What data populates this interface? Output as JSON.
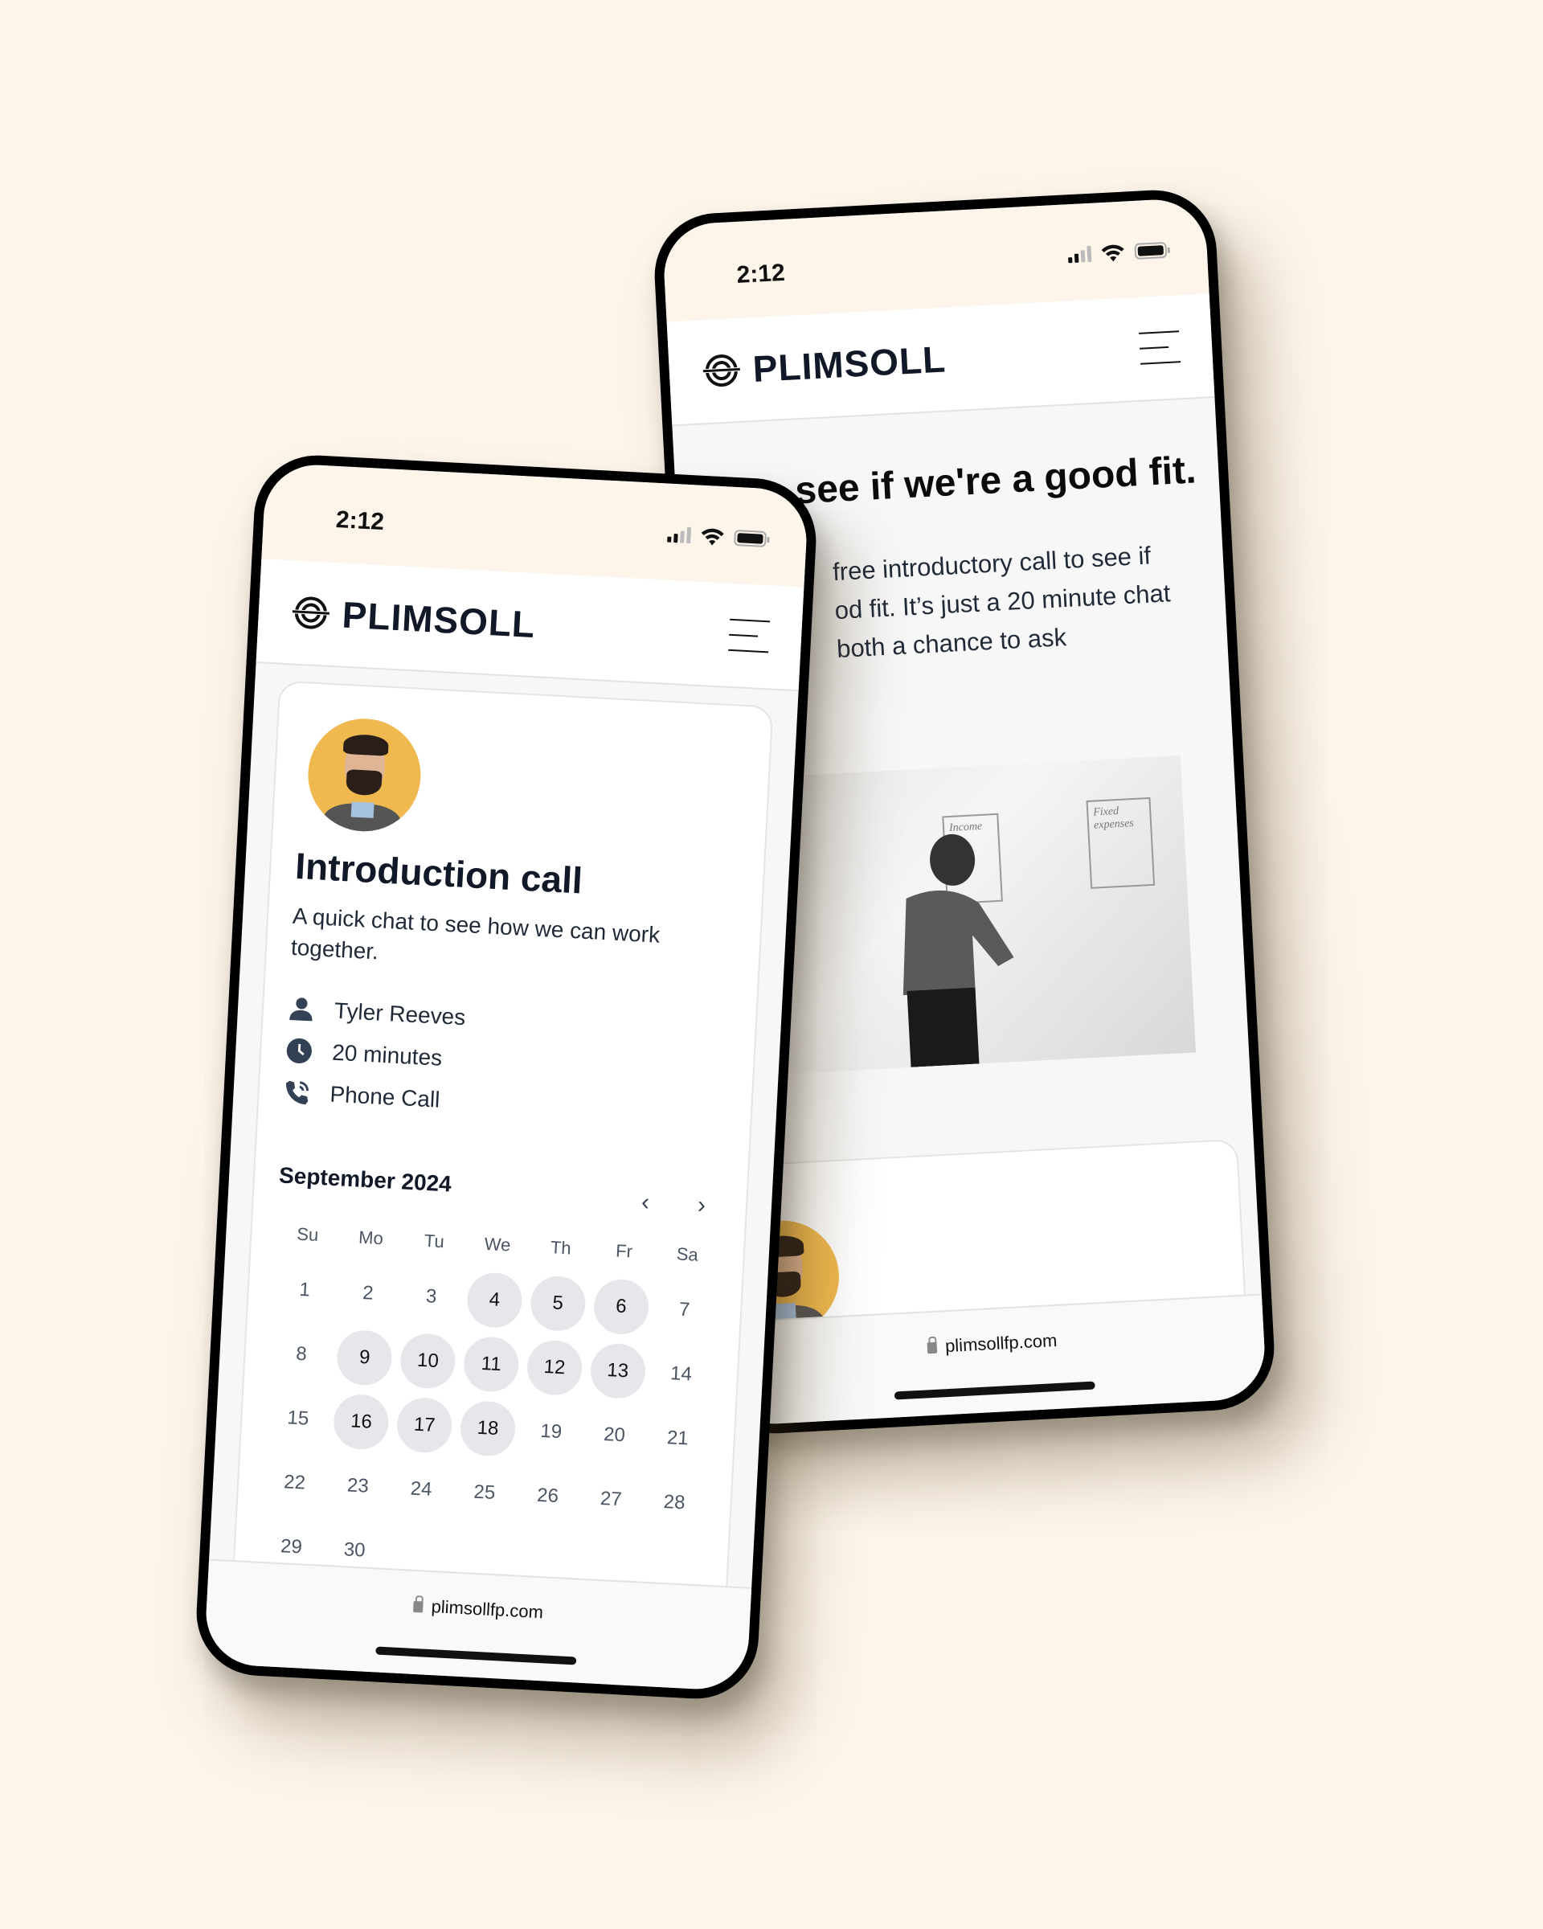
{
  "colors": {
    "background": "#fdf5ea",
    "avatar_bg": "#f0b94f",
    "available_day_bg": "#e5e7eb",
    "text_dark": "#111827"
  },
  "status_bar": {
    "time": "2:12"
  },
  "brand": {
    "name": "PLIMSOLL",
    "logo_icon": "plimsoll-line-icon",
    "menu_icon": "hamburger-menu-icon"
  },
  "browser": {
    "url": "plimsollfp.com",
    "lock_icon": "lock-icon"
  },
  "back_phone": {
    "headline": "...to see if we're a good fit.",
    "body": "...free introductory call to see if ...od fit. It's just a 20 minute chat ...both a chance to ask",
    "body_lines": [
      "free introductory call to see if",
      "od fit. It’s just a 20 minute chat",
      "both a chance to ask"
    ],
    "photo_alt": "Man writing on whiteboard",
    "whiteboard_labels": [
      "Income",
      "Fixed expenses"
    ]
  },
  "front_phone": {
    "event": {
      "title": "Introduction call",
      "description": "A quick chat to see how we can work together.",
      "host": "Tyler Reeves",
      "duration": "20 minutes",
      "location": "Phone Call"
    },
    "calendar": {
      "month_label": "September 2024",
      "prev_label": "‹",
      "next_label": "›",
      "weekdays": [
        "Su",
        "Mo",
        "Tu",
        "We",
        "Th",
        "Fr",
        "Sa"
      ],
      "days": [
        {
          "d": "1",
          "a": false
        },
        {
          "d": "2",
          "a": false
        },
        {
          "d": "3",
          "a": false
        },
        {
          "d": "4",
          "a": true
        },
        {
          "d": "5",
          "a": true
        },
        {
          "d": "6",
          "a": true
        },
        {
          "d": "7",
          "a": false
        },
        {
          "d": "8",
          "a": false
        },
        {
          "d": "9",
          "a": true
        },
        {
          "d": "10",
          "a": true
        },
        {
          "d": "11",
          "a": true
        },
        {
          "d": "12",
          "a": true
        },
        {
          "d": "13",
          "a": true
        },
        {
          "d": "14",
          "a": false
        },
        {
          "d": "15",
          "a": false
        },
        {
          "d": "16",
          "a": true
        },
        {
          "d": "17",
          "a": true
        },
        {
          "d": "18",
          "a": true
        },
        {
          "d": "19",
          "a": false
        },
        {
          "d": "20",
          "a": false
        },
        {
          "d": "21",
          "a": false
        },
        {
          "d": "22",
          "a": false
        },
        {
          "d": "23",
          "a": false
        },
        {
          "d": "24",
          "a": false
        },
        {
          "d": "25",
          "a": false
        },
        {
          "d": "26",
          "a": false
        },
        {
          "d": "27",
          "a": false
        },
        {
          "d": "28",
          "a": false
        },
        {
          "d": "29",
          "a": false
        },
        {
          "d": "30",
          "a": false
        }
      ]
    }
  }
}
